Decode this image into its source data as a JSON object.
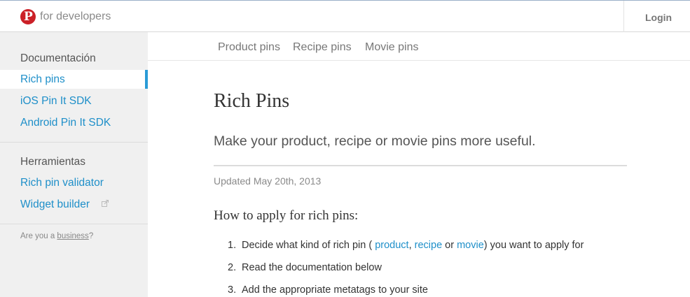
{
  "header": {
    "brand_text": "for developers",
    "login_label": "Login",
    "logo_letter": "P",
    "logo_color": "#cb2027"
  },
  "sidebar": {
    "section1_title": "Documentación",
    "section1_items": [
      "Rich pins",
      "iOS Pin It SDK",
      "Android Pin It SDK"
    ],
    "active_item": "Rich pins",
    "section2_title": "Herramientas",
    "section2_items": [
      "Rich pin validator",
      "Widget builder"
    ],
    "footer_prefix": "Are you a ",
    "footer_link": "business",
    "footer_suffix": "?"
  },
  "subnav": {
    "tabs": [
      "Product pins",
      "Recipe pins",
      "Movie pins"
    ]
  },
  "main": {
    "title": "Rich Pins",
    "subtitle": "Make your product, recipe or movie pins more useful.",
    "updated": "Updated May 20th, 2013",
    "section_heading": "How to apply for rich pins:",
    "steps": {
      "step1": {
        "num": "1.",
        "prefix": "Decide what kind of rich pin ( ",
        "link1": "product",
        "sep1": ", ",
        "link2": "recipe",
        "sep2": " or ",
        "link3": "movie",
        "suffix": ") you want to apply for"
      },
      "step2": {
        "num": "2.",
        "text": "Read the documentation below"
      },
      "step3": {
        "num": "3.",
        "text": "Add the appropriate metatags to your site"
      }
    }
  },
  "colors": {
    "link": "#1e8fc9",
    "active_indicator": "#2a9bd6",
    "sidebar_bg": "#f0f0f0"
  }
}
